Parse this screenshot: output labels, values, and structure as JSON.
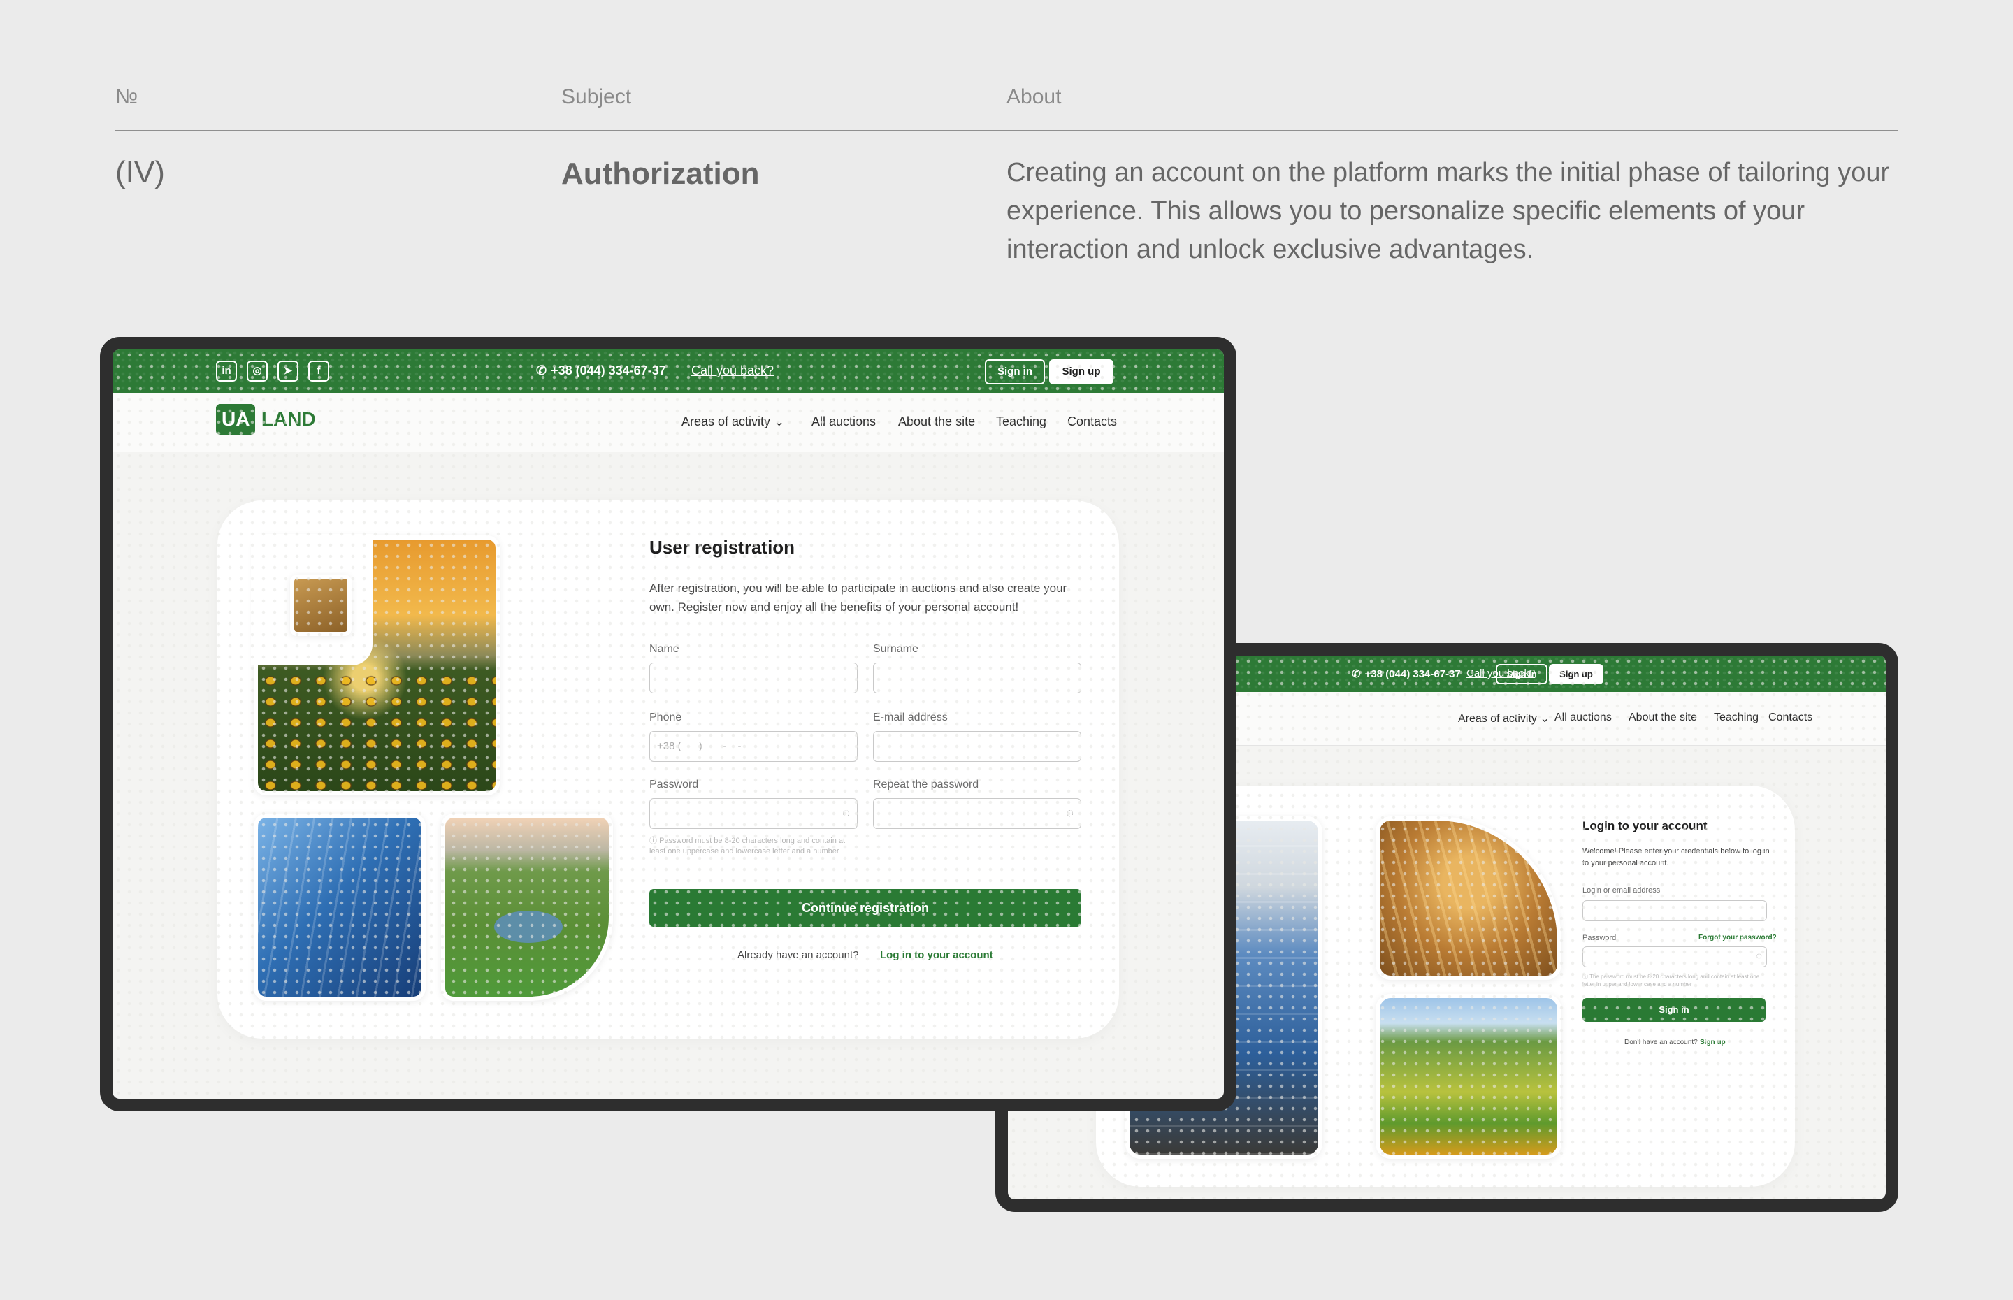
{
  "header": {
    "col_number": "№",
    "col_subject": "Subject",
    "col_about": "About",
    "number": "(IV)",
    "subject": "Authorization",
    "about": "Creating an account on the platform marks the initial phase of tailoring your experience. This allows you to personalize specific elements of your interaction and unlock exclusive advantages."
  },
  "site": {
    "social": [
      "in",
      "◎",
      "➤",
      "f"
    ],
    "phone": "+38 (044) 334-67-37",
    "callback": "Call you back?",
    "sign_in": "Sign in",
    "sign_up": "Sign up",
    "logo_ua": "UA",
    "logo_land": "LAND",
    "nav": [
      "Areas of activity",
      "All auctions",
      "About the site",
      "Teaching",
      "Contacts"
    ],
    "nav_dropdown_icon": "chevron-down-icon"
  },
  "registration": {
    "title": "User registration",
    "intro": "After registration, you will be able to participate in auctions and also create your own. Register now and enjoy all the benefits of your personal account!",
    "name_label": "Name",
    "surname_label": "Surname",
    "phone_label": "Phone",
    "phone_placeholder": "+38 (___) ___-__-__",
    "email_label": "E-mail address",
    "password_label": "Password",
    "repeat_label": "Repeat the password",
    "password_hint": "Password must be 8-20 characters long and contain at least one uppercase and lowercase letter and a number",
    "continue_button": "Continue registration",
    "have_account": "Already have an account?",
    "login_link": "Log in to your account"
  },
  "login": {
    "title": "Login to your account",
    "intro": "Welcome! Please enter your credentials below to log in to your personal account.",
    "login_label": "Login or email address",
    "password_label": "Password",
    "forgot_link": "Forgot your password?",
    "password_hint": "The password must be 8-20 characters long and contain at least one letter in upper and lower case and a number",
    "sign_in_button": "Sign in",
    "no_account": "Don't have an account?",
    "sign_up_link": "Sign up"
  },
  "colors": {
    "brand_green": "#2d7a36",
    "background": "#ebebeb",
    "frame": "#2e2e2e"
  }
}
